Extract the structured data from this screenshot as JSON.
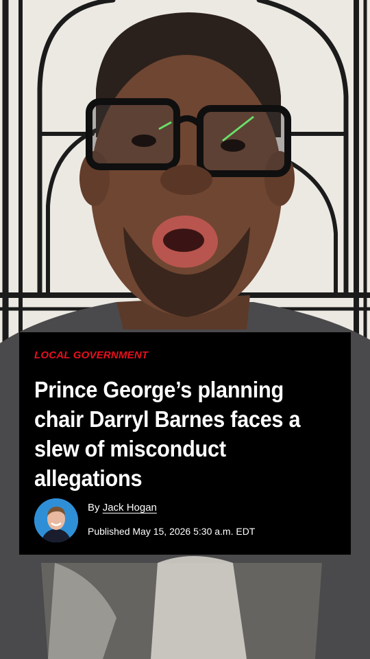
{
  "article": {
    "kicker": "LOCAL GOVERNMENT",
    "headline": "Prince George’s planning chair Darryl Barnes faces a slew of misconduct allegations",
    "byline_prefix": "By",
    "author": "Jack Hogan",
    "published": "Published May 15, 2026 5:30 a.m. EDT"
  },
  "colors": {
    "kicker": "#e7101d",
    "card_background": "#000000",
    "avatar_background": "#2f8fd6",
    "wall": "#ece9e3"
  },
  "icons": {
    "avatar": "author-headshot"
  }
}
